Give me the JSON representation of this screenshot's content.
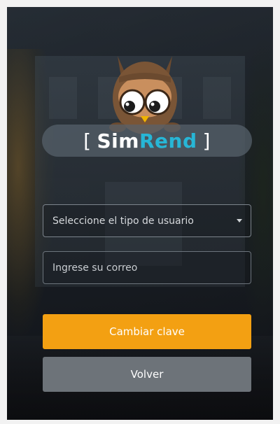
{
  "app": {
    "logo": {
      "bracket_open": "[",
      "part1": "Sim",
      "part2": "Rend",
      "bracket_close": "]"
    },
    "accent_color": "#27b6d6"
  },
  "form": {
    "user_type_select": {
      "placeholder": "Seleccione el tipo de usuario"
    },
    "email_input": {
      "placeholder": "Ingrese su correo"
    },
    "submit_label": "Cambiar clave",
    "back_label": "Volver"
  },
  "colors": {
    "primary_button": "#f3a012",
    "secondary_button": "#6d7379"
  },
  "icons": {
    "mascot": "owl-mascot-icon",
    "select_caret": "caret-down-icon"
  }
}
